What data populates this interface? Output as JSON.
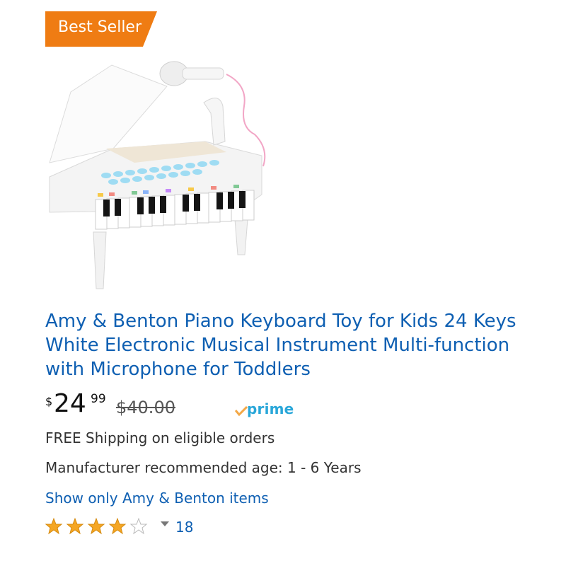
{
  "badge": {
    "label": "Best Seller",
    "color": "#ef7c13"
  },
  "product": {
    "image_icon": "toy-piano-image",
    "title": "Amy & Benton Piano Keyboard Toy for Kids 24 Keys White Electronic Musical Instrument Multi-function with Microphone for Toddlers",
    "price": {
      "currency": "$",
      "whole": "24",
      "fraction": "99"
    },
    "list_price": "$40.00",
    "prime_label": "prime",
    "shipping": "FREE Shipping on eligible orders",
    "age": "Manufacturer recommended age: 1 - 6 Years",
    "brand_link": "Show only Amy & Benton items",
    "rating": {
      "stars": 4,
      "out_of": 5,
      "count": "18"
    }
  },
  "colors": {
    "link": "#0e5fb2",
    "star": "#f5a623",
    "prime": "#2aa7d9"
  }
}
